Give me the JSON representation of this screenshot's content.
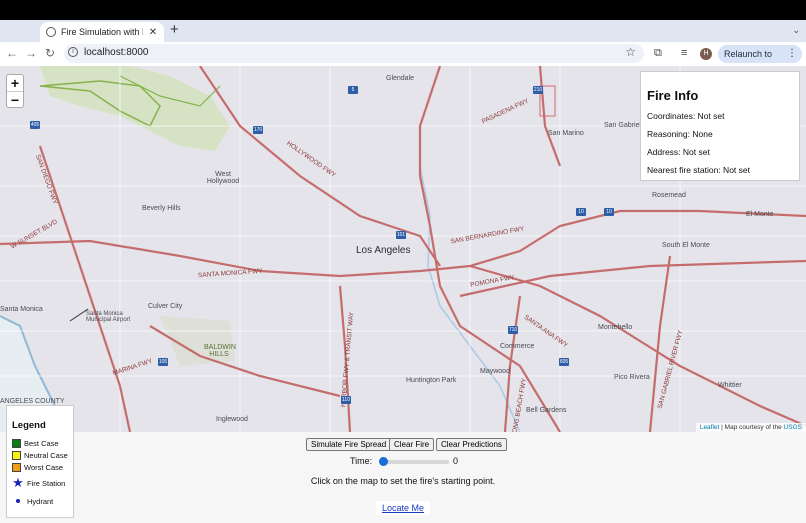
{
  "browser": {
    "tab_title": "Fire Simulation with Real-Tim",
    "url": "localhost:8000",
    "profile_initial": "H",
    "relaunch_label": "Relaunch to update"
  },
  "map": {
    "zoom_in": "+",
    "zoom_out": "−",
    "labels": {
      "glendale": "Glendale",
      "pasadena_fwy": "PASADENA FWY",
      "san_marino": "San Marino",
      "san_gabriel": "San Gabriel",
      "hollywood_fwy": "HOLLYWOOD FWY",
      "west_hollywood": "West Hollywood",
      "beverly_hills": "Beverly Hills",
      "rosemead": "Rosemead",
      "el_monte": "El Monte",
      "los_angeles": "Los Angeles",
      "san_bernardino_fwy": "SAN BERNARDINO FWY",
      "south_el_monte": "South El Monte",
      "santa_monica_fwy": "SANTA MONICA FWY",
      "pomona_fwy": "POMONA FWY",
      "santa_monica": "Santa Monica",
      "culver_city": "Culver City",
      "airport": "Santa Monica Municipal Airport",
      "baldwin_hills": "BALDWIN HILLS",
      "montebello": "Montebello",
      "commerce": "Commerce",
      "marina_fwy": "MARINA FWY",
      "huntington_park": "Huntington Park",
      "maywood": "Maywood",
      "pico_rivera": "Pico Rivera",
      "whittier": "Whittier",
      "angeles_county": "ANGELES COUNTY",
      "inglewood": "Inglewood",
      "bell_gardens": "Bell Gardens",
      "sunset_blvd": "W SUNSET BLVD",
      "san_diego_fwy": "SAN DIEGO FWY",
      "harbor_fwy": "HARBOR FWY & TRANSIT WAY",
      "long_beach_fwy": "LONG BEACH FWY",
      "santa_ana_fwy": "SANTA ANA FWY",
      "san_gabriel_river_fwy": "SAN GABRIEL RIVER FWY"
    },
    "shields": {
      "i5": "5",
      "i10": "10",
      "i10b": "10",
      "i110": "110",
      "i405": "405",
      "i105": "105",
      "i710": "710",
      "i605": "605",
      "i210": "210",
      "i101": "101",
      "i170": "170"
    },
    "attribution": {
      "leaflet": "Leaflet",
      "rest": "| Map courtesy of the",
      "usgs": "USGS"
    }
  },
  "fire_info": {
    "title": "Fire Info",
    "coordinates": "Coordinates: Not set",
    "reasoning": "Reasoning: None",
    "address": "Address: Not set",
    "nearest_station": "Nearest fire station: Not set"
  },
  "controls": {
    "simulate_label": "Simulate Fire Spread",
    "clear_fire_label": "Clear Fire",
    "clear_predictions_label": "Clear Predictions",
    "time_label": "Time:",
    "time_value": "0",
    "hint": "Click on the map to set the fire's starting point.",
    "locate_label": "Locate Me"
  },
  "legend": {
    "title": "Legend",
    "items": [
      {
        "label": "Best Case",
        "color": "#0a7d12"
      },
      {
        "label": "Neutral Case",
        "color": "#f7f10c"
      },
      {
        "label": "Worst Case",
        "color": "#f29d16"
      }
    ],
    "station_label": "Fire Station",
    "hydrant_label": "Hydrant",
    "marker_color": "#1a23b8"
  },
  "colors": {
    "freeway": "#c56d6d",
    "road": "#ffffff",
    "park": "#c9dbb2",
    "water": "#a9cbe6"
  }
}
